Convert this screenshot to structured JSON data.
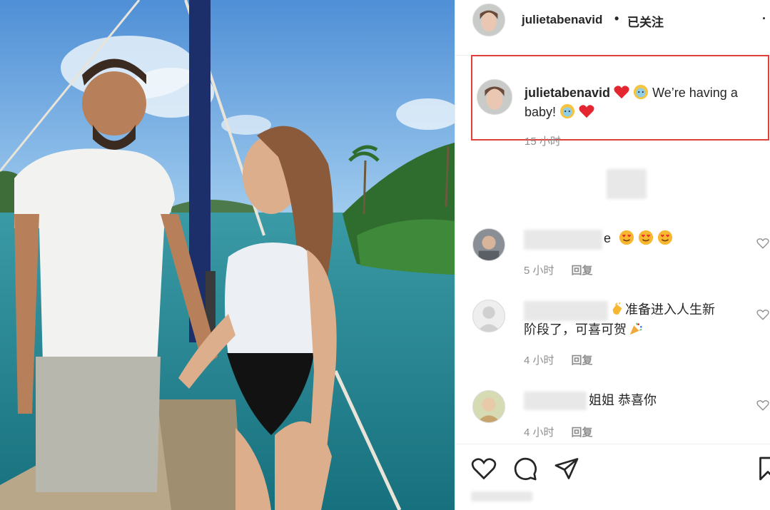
{
  "post": {
    "username": "julietabenavid",
    "follow_status": "已关注",
    "separator": "•",
    "more_label": "·",
    "caption_lines": [
      "We’re having a",
      "baby!"
    ],
    "caption_time": "15 小时"
  },
  "comments": [
    {
      "text": "e",
      "emoji": "smiling-face-with-hearts x3",
      "time": "5 小时",
      "reply": "回复"
    },
    {
      "text_line1": "准备进入人生新",
      "text_line2": "阶段了，可喜可贺",
      "time": "4 小时",
      "reply": "回复"
    },
    {
      "text": "姐姐 恭喜你",
      "time": "4 小时",
      "reply": "回复"
    }
  ],
  "icons": [
    "heart-icon",
    "comment-icon",
    "share-icon",
    "bookmark-icon",
    "more-icon"
  ],
  "colors": {
    "highlight_border": "#e0403a",
    "heart_red": "#e3262f",
    "muted_text": "#8e8e8e"
  }
}
